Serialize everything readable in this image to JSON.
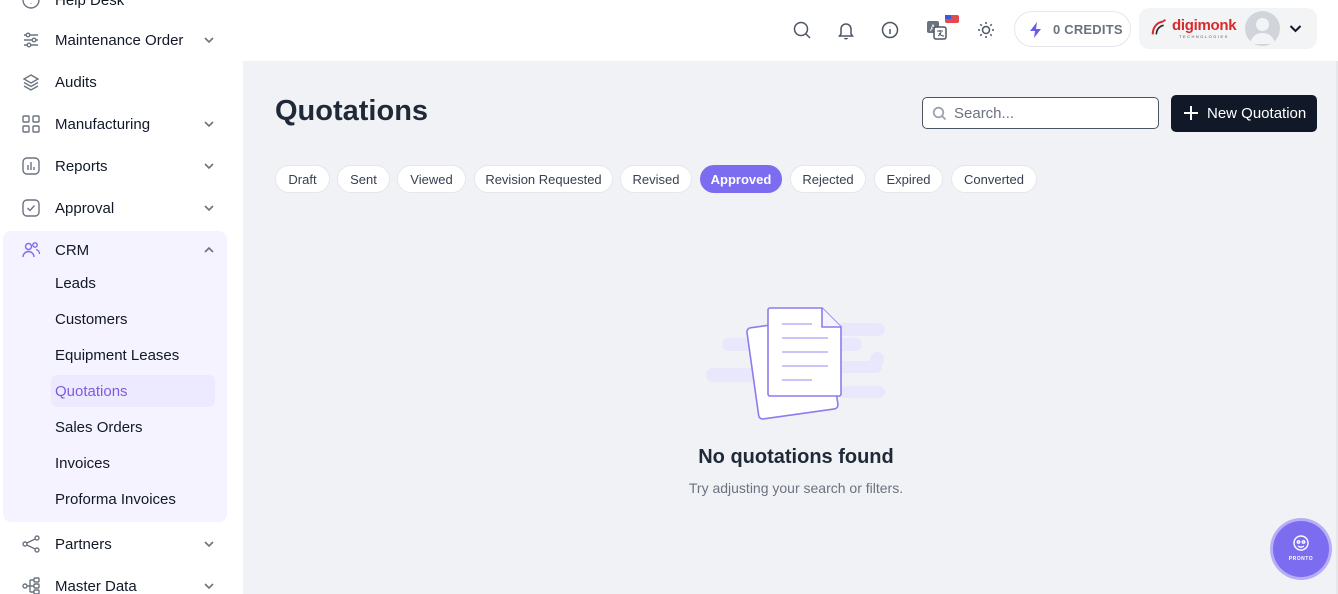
{
  "sidebar": {
    "partial_top": "Help Desk",
    "items": [
      {
        "label": "Maintenance Order",
        "icon": "sliders-icon"
      },
      {
        "label": "Audits",
        "icon": "layers-icon"
      },
      {
        "label": "Manufacturing",
        "icon": "grid-icon"
      },
      {
        "label": "Reports",
        "icon": "chart-icon"
      },
      {
        "label": "Approval",
        "icon": "check-square-icon"
      },
      {
        "label": "CRM",
        "icon": "users-icon"
      },
      {
        "label": "Partners",
        "icon": "share-icon"
      },
      {
        "label": "Master Data",
        "icon": "hierarchy-icon"
      }
    ],
    "crm_sub": [
      "Leads",
      "Customers",
      "Equipment Leases",
      "Quotations",
      "Sales Orders",
      "Invoices",
      "Proforma Invoices"
    ]
  },
  "header": {
    "credits": "0 CREDITS",
    "brand": "digimonk",
    "brand_sub": "TECHNOLOGIES"
  },
  "main": {
    "title": "Quotations",
    "search_placeholder": "Search...",
    "new_button": "New Quotation",
    "filters": [
      "Draft",
      "Sent",
      "Viewed",
      "Revision Requested",
      "Revised",
      "Approved",
      "Rejected",
      "Expired",
      "Converted"
    ],
    "active_filter": "Approved",
    "empty_title": "No quotations found",
    "empty_subtitle": "Try adjusting your search or filters."
  },
  "assistant": {
    "label": "PRONTO"
  },
  "colors": {
    "accent": "#7c6cf0",
    "dark_button": "#111827",
    "brand_red": "#d62b2b"
  }
}
